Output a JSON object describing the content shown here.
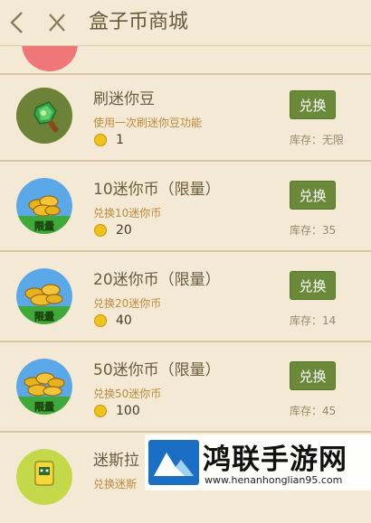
{
  "header": {
    "title": "盒子币商城"
  },
  "items": [
    {
      "name": "刷迷你豆",
      "desc": "使用一次刷迷你豆功能",
      "price": "1",
      "button": "兑换",
      "stock": "库存：无限",
      "badge": ""
    },
    {
      "name": "10迷你币（限量）",
      "desc": "兑换10迷你币",
      "price": "20",
      "button": "兑换",
      "stock": "库存：35",
      "badge": "限量"
    },
    {
      "name": "20迷你币（限量）",
      "desc": "兑换20迷你币",
      "price": "40",
      "button": "兑换",
      "stock": "库存：14",
      "badge": "限量"
    },
    {
      "name": "50迷你币（限量）",
      "desc": "兑换50迷你币",
      "price": "100",
      "button": "兑换",
      "stock": "库存：45",
      "badge": "限量"
    },
    {
      "name": "迷斯拉",
      "desc": "兑换迷斯",
      "price": "",
      "button": "",
      "stock": "",
      "badge": ""
    }
  ],
  "watermark": {
    "title": "鸿联手游网",
    "url": "www.henanhonglian95.com"
  },
  "icons": [
    "back-arrow-icon",
    "close-icon",
    "mini-bean-brush-icon",
    "gold-coins-icon",
    "green-robot-icon"
  ],
  "colors": {
    "background": "#f3e9d4",
    "button": "#6a8a3a",
    "title": "#6a5a3e",
    "accent": "#c08a3c"
  }
}
